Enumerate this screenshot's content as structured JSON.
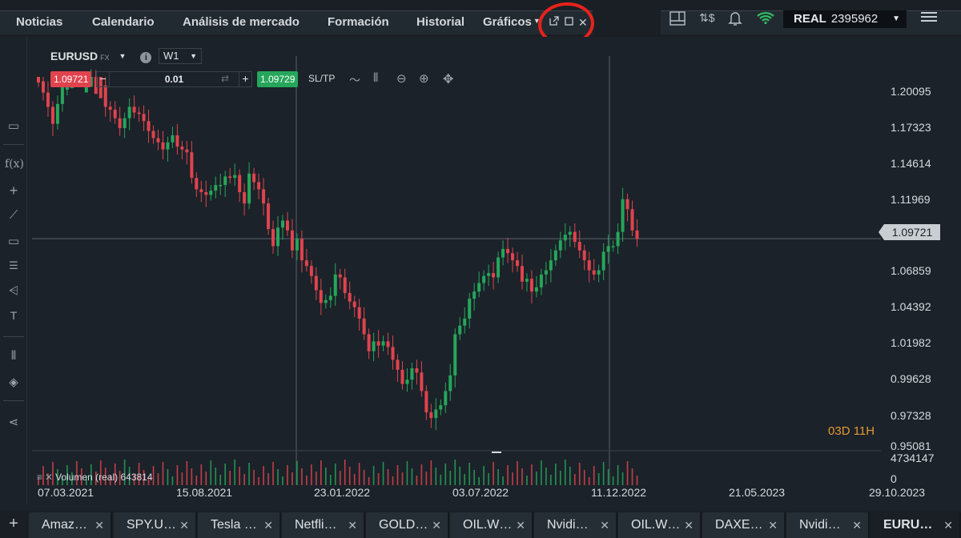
{
  "nav": {
    "tabs": [
      {
        "label": "Noticias"
      },
      {
        "label": "Calendario"
      },
      {
        "label": "Análisis de mercado"
      },
      {
        "label": "Formación"
      },
      {
        "label": "Historial"
      },
      {
        "label": "Gráficos"
      }
    ],
    "active_tab": "Gráficos"
  },
  "account": {
    "type": "REAL",
    "number": "2395962"
  },
  "instrument": {
    "symbol": "EURUSD",
    "market": "FX",
    "timeframe": "W1"
  },
  "trade": {
    "sell_price": "1.09721",
    "buy_price": "1.09729",
    "quantity": "0.01",
    "sltp_label": "SL/TP"
  },
  "colors": {
    "up": "#26a65b",
    "down": "#e0434e",
    "background": "#1b2229",
    "accent_warning": "#e39a35",
    "annotation": "#e8221a"
  },
  "chart_data": {
    "type": "candlestick",
    "price_axis_ticks": [
      "1.20095",
      "1.17323",
      "1.14614",
      "1.11969",
      "1.09721",
      "1.06859",
      "1.04392",
      "1.01982",
      "0.99628",
      "0.97328",
      "0.95081"
    ],
    "ylim": [
      0.95081,
      1.20095
    ],
    "date_axis_ticks": [
      "07.03.2021",
      "15.08.2021",
      "23.01.2022",
      "03.07.2022",
      "11.12.2022",
      "21.05.2023",
      "29.10.2023"
    ],
    "last_price": "1.09721",
    "countdown": {
      "days": "03",
      "days_unit": "D",
      "hours": "11",
      "hours_unit": "H"
    },
    "volume": {
      "label": "Volumen (real)",
      "value": "643814",
      "max": "4734147",
      "min": "0"
    },
    "closes_approx": [
      1.208,
      1.2,
      1.19,
      1.178,
      1.192,
      1.205,
      1.214,
      1.222,
      1.218,
      1.214,
      1.225,
      1.232,
      1.22,
      1.205,
      1.19,
      1.188,
      1.182,
      1.175,
      1.182,
      1.19,
      1.186,
      1.185,
      1.18,
      1.173,
      1.168,
      1.165,
      1.16,
      1.165,
      1.17,
      1.162,
      1.16,
      1.158,
      1.14,
      1.132,
      1.13,
      1.128,
      1.131,
      1.135,
      1.135,
      1.141,
      1.14,
      1.142,
      1.13,
      1.122,
      1.143,
      1.137,
      1.132,
      1.122,
      1.104,
      1.092,
      1.105,
      1.11,
      1.103,
      1.089,
      1.097,
      1.082,
      1.078,
      1.071,
      1.061,
      1.052,
      1.054,
      1.057,
      1.072,
      1.07,
      1.059,
      1.053,
      1.049,
      1.041,
      1.03,
      1.018,
      1.025,
      1.022,
      1.025,
      1.021,
      1.012,
      1.005,
      0.995,
      0.998,
      1.006,
      1.003,
      0.99,
      0.975,
      0.971,
      0.977,
      0.98,
      0.99,
      1.001,
      1.03,
      1.036,
      1.041,
      1.055,
      1.06,
      1.066,
      1.071,
      1.073,
      1.07,
      1.084,
      1.09,
      1.087,
      1.082,
      1.078,
      1.067,
      1.069,
      1.06,
      1.063,
      1.072,
      1.075,
      1.082,
      1.089,
      1.096,
      1.1,
      1.102,
      1.095,
      1.089,
      1.082,
      1.075,
      1.072,
      1.075,
      1.088,
      1.092,
      1.092,
      1.102,
      1.125,
      1.118,
      1.103,
      1.097
    ]
  },
  "bottom_tabs": [
    {
      "label": "Amaz…"
    },
    {
      "label": "SPY.U…"
    },
    {
      "label": "Tesla …"
    },
    {
      "label": "Netfli…"
    },
    {
      "label": "GOLD…"
    },
    {
      "label": "OIL.W…"
    },
    {
      "label": "Nvidi…"
    },
    {
      "label": "OIL.W…"
    },
    {
      "label": "DAXE…"
    },
    {
      "label": "Nvidi…"
    },
    {
      "label": "EURU…"
    }
  ]
}
